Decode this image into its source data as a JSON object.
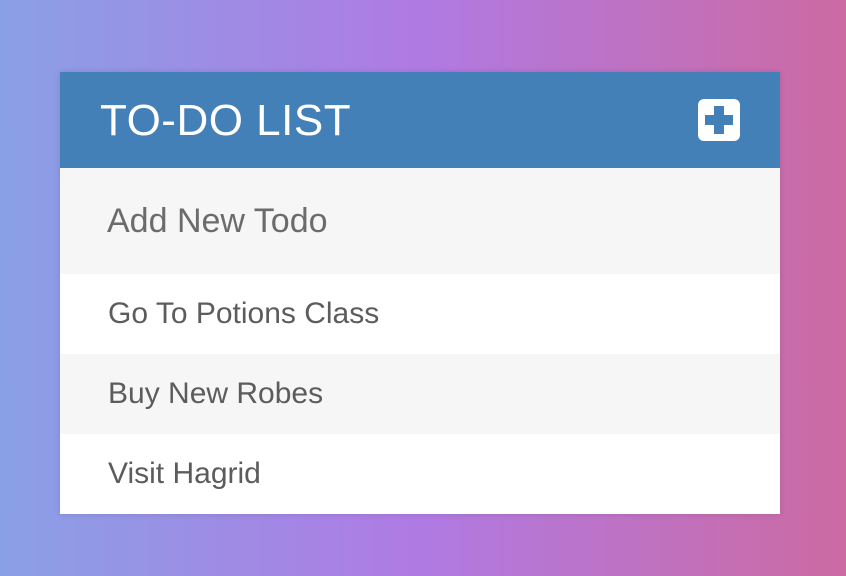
{
  "header": {
    "title": "TO-DO LIST",
    "add_icon": "plus-square-icon"
  },
  "new_todo": {
    "placeholder": "Add New Todo",
    "value": ""
  },
  "todos": [
    {
      "text": "Go To Potions Class"
    },
    {
      "text": "Buy New Robes"
    },
    {
      "text": "Visit Hagrid"
    }
  ],
  "colors": {
    "header_bg": "#4380b8",
    "input_bg": "#f6f6f6",
    "stripe_bg": "#f6f6f6",
    "text": "#5c5c5c",
    "gradient_start": "#8aa0e6",
    "gradient_mid": "#b07ae3",
    "gradient_end": "#cc6aa2"
  }
}
